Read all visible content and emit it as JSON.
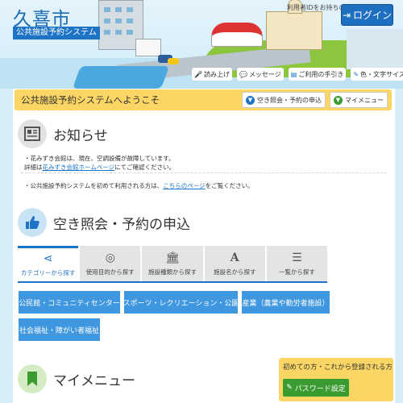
{
  "header": {
    "city_name": "久喜市",
    "system_name": "公共施設予約システム",
    "id_note": "利用者IDをお持ちの方",
    "login_label": "ログイン",
    "util_links": [
      {
        "icon": "speaker-icon",
        "label": "読み上げ"
      },
      {
        "icon": "message-icon",
        "label": "メッセージ"
      },
      {
        "icon": "book-icon",
        "label": "ご利用の手引き"
      },
      {
        "icon": "brush-icon",
        "label": "色・文字サイズ変更"
      }
    ]
  },
  "welcome": {
    "text": "公共施設予約システムへようこそ",
    "vacancy_button": "空き照会・予約の申込",
    "mymenu_button": "マイメニュー"
  },
  "notice": {
    "title": "お知らせ",
    "line1": "・花みずき会館は、現在、空調設備が故障しています。",
    "line2_prefix": "詳細は",
    "line2_link": "花みずき会館ホームページ",
    "line2_suffix": "にてご確認ください。",
    "line3_prefix": "・公共施設予約システムを初めて利用される方は、",
    "line3_link": "こちらのページ",
    "line3_suffix": "をご覧ください。"
  },
  "reservation": {
    "title": "空き照会・予約の申込",
    "tabs": [
      {
        "icon": "share-icon",
        "label": "カテゴリーから探す",
        "active": true
      },
      {
        "icon": "compass-icon",
        "label": "使用目的から探す",
        "active": false
      },
      {
        "icon": "building-icon",
        "label": "施設種類から探す",
        "active": false
      },
      {
        "icon": "font-icon",
        "label": "施設名から探す",
        "active": false
      },
      {
        "icon": "list-icon",
        "label": "一覧から探す",
        "active": false
      }
    ],
    "categories": [
      "公民館・コミュニティセンター",
      "スポーツ・レクリエーション・公園",
      "産業（農業や勤労者施設）",
      "社会福祉・障がい者福祉"
    ]
  },
  "mymenu": {
    "title": "マイメニュー",
    "side_text": "初めての方・これから登録される方",
    "password_button": "パスワード設定"
  },
  "colors": {
    "brand_blue": "#1d74c6",
    "category_blue": "#3f97e0",
    "yellow": "#fbd665",
    "green": "#3a9b31"
  }
}
